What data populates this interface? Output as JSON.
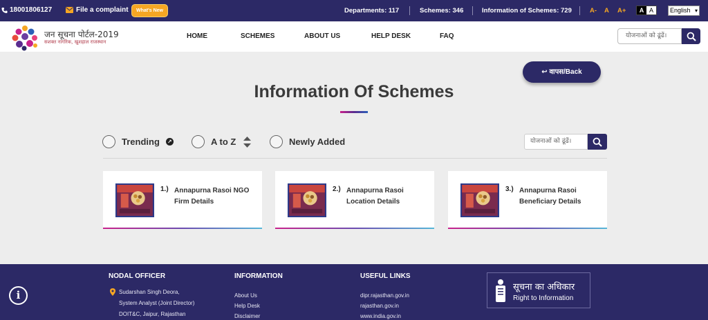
{
  "topbar": {
    "phone": "18001806127",
    "complaint": "File a complaint",
    "whats_new": "What's New",
    "departments": "Departments: 117",
    "schemes": "Schemes: 346",
    "information": "Information of Schemes: 729",
    "font_decrease": "A-",
    "font_normal": "A",
    "font_increase": "A+",
    "contrast_dark": "A",
    "contrast_light": "A",
    "language": "English"
  },
  "brand": {
    "title": "जन सूचना पोर्टल-2019",
    "tagline": "सशक्त नागरिक, खुशहाल राजस्थान"
  },
  "nav": {
    "items": [
      "HOME",
      "SCHEMES",
      "ABOUT US",
      "HELP DESK",
      "FAQ"
    ],
    "search_placeholder": "योजनाओं को ढूंढें।"
  },
  "main": {
    "back_label": "वापस/Back",
    "title": "Information Of Schemes",
    "filters": [
      "Trending",
      "A to Z",
      "Newly Added"
    ],
    "search_placeholder": "योजनाओं को ढूंढें।",
    "cards": [
      {
        "num": "1.)",
        "title": "Annapurna Rasoi NGO Firm Details"
      },
      {
        "num": "2.)",
        "title": "Annapurna Rasoi Location Details"
      },
      {
        "num": "3.)",
        "title": "Annapurna Rasoi Beneficiary Details"
      }
    ]
  },
  "footer": {
    "nodal_head": "NODAL OFFICER",
    "nodal_lines": [
      "Sudarshan Singh Deora,",
      "System Analyst (Joint Director)",
      "DOIT&C, Jaipur, Rajasthan"
    ],
    "info_head": "INFORMATION",
    "info_links": [
      "About Us",
      "Help Desk",
      "Disclaimer"
    ],
    "useful_head": "USEFUL LINKS",
    "useful_links": [
      "dipr.rajasthan.gov.in",
      "rajasthan.gov.in",
      "www.india.gov.in"
    ],
    "rti_hindi": "सूचना का अधिकार",
    "rti_english": "Right to Information"
  },
  "colors": {
    "primary": "#2c2966",
    "accent": "#f6a623",
    "background": "#ededed"
  }
}
